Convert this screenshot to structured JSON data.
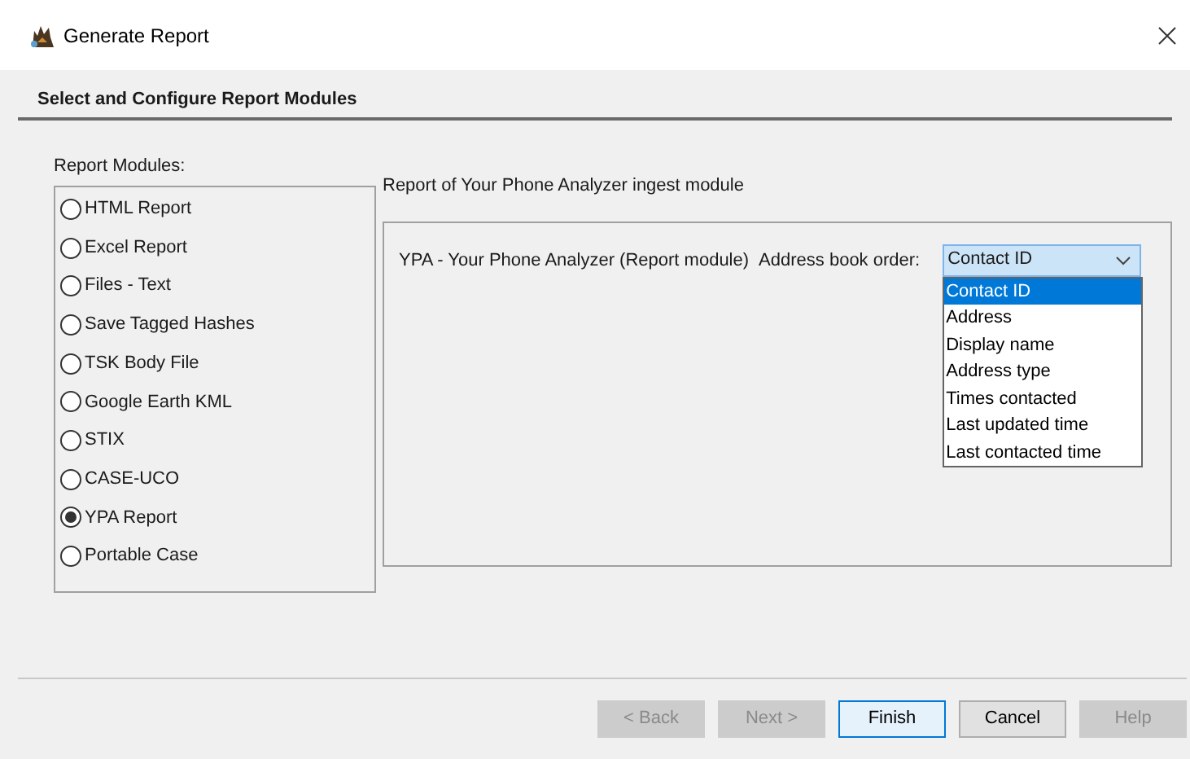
{
  "window": {
    "title": "Generate Report"
  },
  "header": "Select and Configure Report Modules",
  "modules_label": "Report Modules:",
  "modules": [
    {
      "label": "HTML Report",
      "selected": false
    },
    {
      "label": "Excel Report",
      "selected": false
    },
    {
      "label": "Files - Text",
      "selected": false
    },
    {
      "label": "Save Tagged Hashes",
      "selected": false
    },
    {
      "label": "TSK Body File",
      "selected": false
    },
    {
      "label": "Google Earth KML",
      "selected": false
    },
    {
      "label": "STIX",
      "selected": false
    },
    {
      "label": "CASE-UCO",
      "selected": false
    },
    {
      "label": "YPA Report",
      "selected": true
    },
    {
      "label": "Portable Case",
      "selected": false
    }
  ],
  "config": {
    "description": "Report of Your Phone Analyzer ingest module",
    "module_name": "YPA - Your Phone Analyzer (Report module)",
    "field_label": "Address book order:",
    "dropdown": {
      "value": "Contact ID",
      "expanded": true,
      "options": [
        {
          "label": "Contact ID",
          "selected": true
        },
        {
          "label": "Address",
          "selected": false
        },
        {
          "label": "Display name",
          "selected": false
        },
        {
          "label": "Address type",
          "selected": false
        },
        {
          "label": "Times contacted",
          "selected": false
        },
        {
          "label": "Last updated time",
          "selected": false
        },
        {
          "label": "Last contacted time",
          "selected": false
        }
      ]
    }
  },
  "buttons": [
    {
      "label": "< Back",
      "disabled": true,
      "default": false
    },
    {
      "label": "Next >",
      "disabled": true,
      "default": false
    },
    {
      "label": "Finish",
      "disabled": false,
      "default": true
    },
    {
      "label": "Cancel",
      "disabled": false,
      "default": false
    },
    {
      "label": "Help",
      "disabled": true,
      "default": false
    }
  ]
}
